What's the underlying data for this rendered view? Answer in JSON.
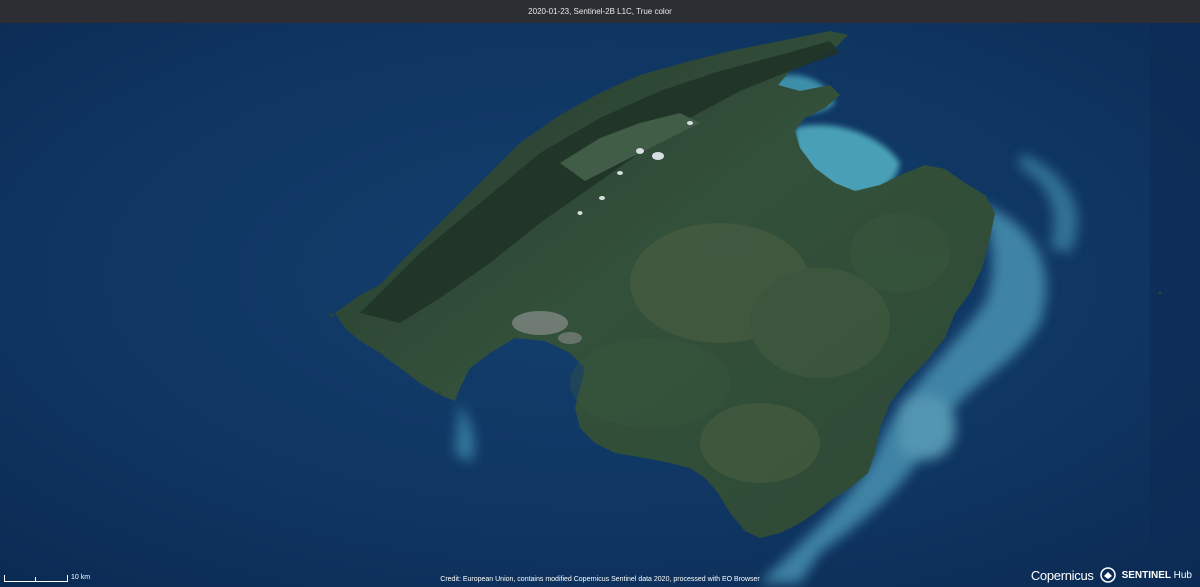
{
  "header": {
    "title": "2020-01-23, Sentinel-2B L1C, True color"
  },
  "footer": {
    "credit": "Credit: European Union, contains modified Copernicus Sentinel data 2020, processed with EO Browser",
    "scale_label": "10 km"
  },
  "logos": {
    "copernicus": "Copernicus",
    "sentinel": "SENTINEL",
    "hub": "Hub"
  },
  "imagery": {
    "icon": "satellite-image-majorca",
    "colors": {
      "sea_deep": "#0b2b55",
      "sea_mid": "#123d6c",
      "land": "#2f4a35",
      "land_dark": "#1f3326",
      "sediment": "#5aa9c4",
      "bay_shallow": "#3f8fa8"
    }
  }
}
